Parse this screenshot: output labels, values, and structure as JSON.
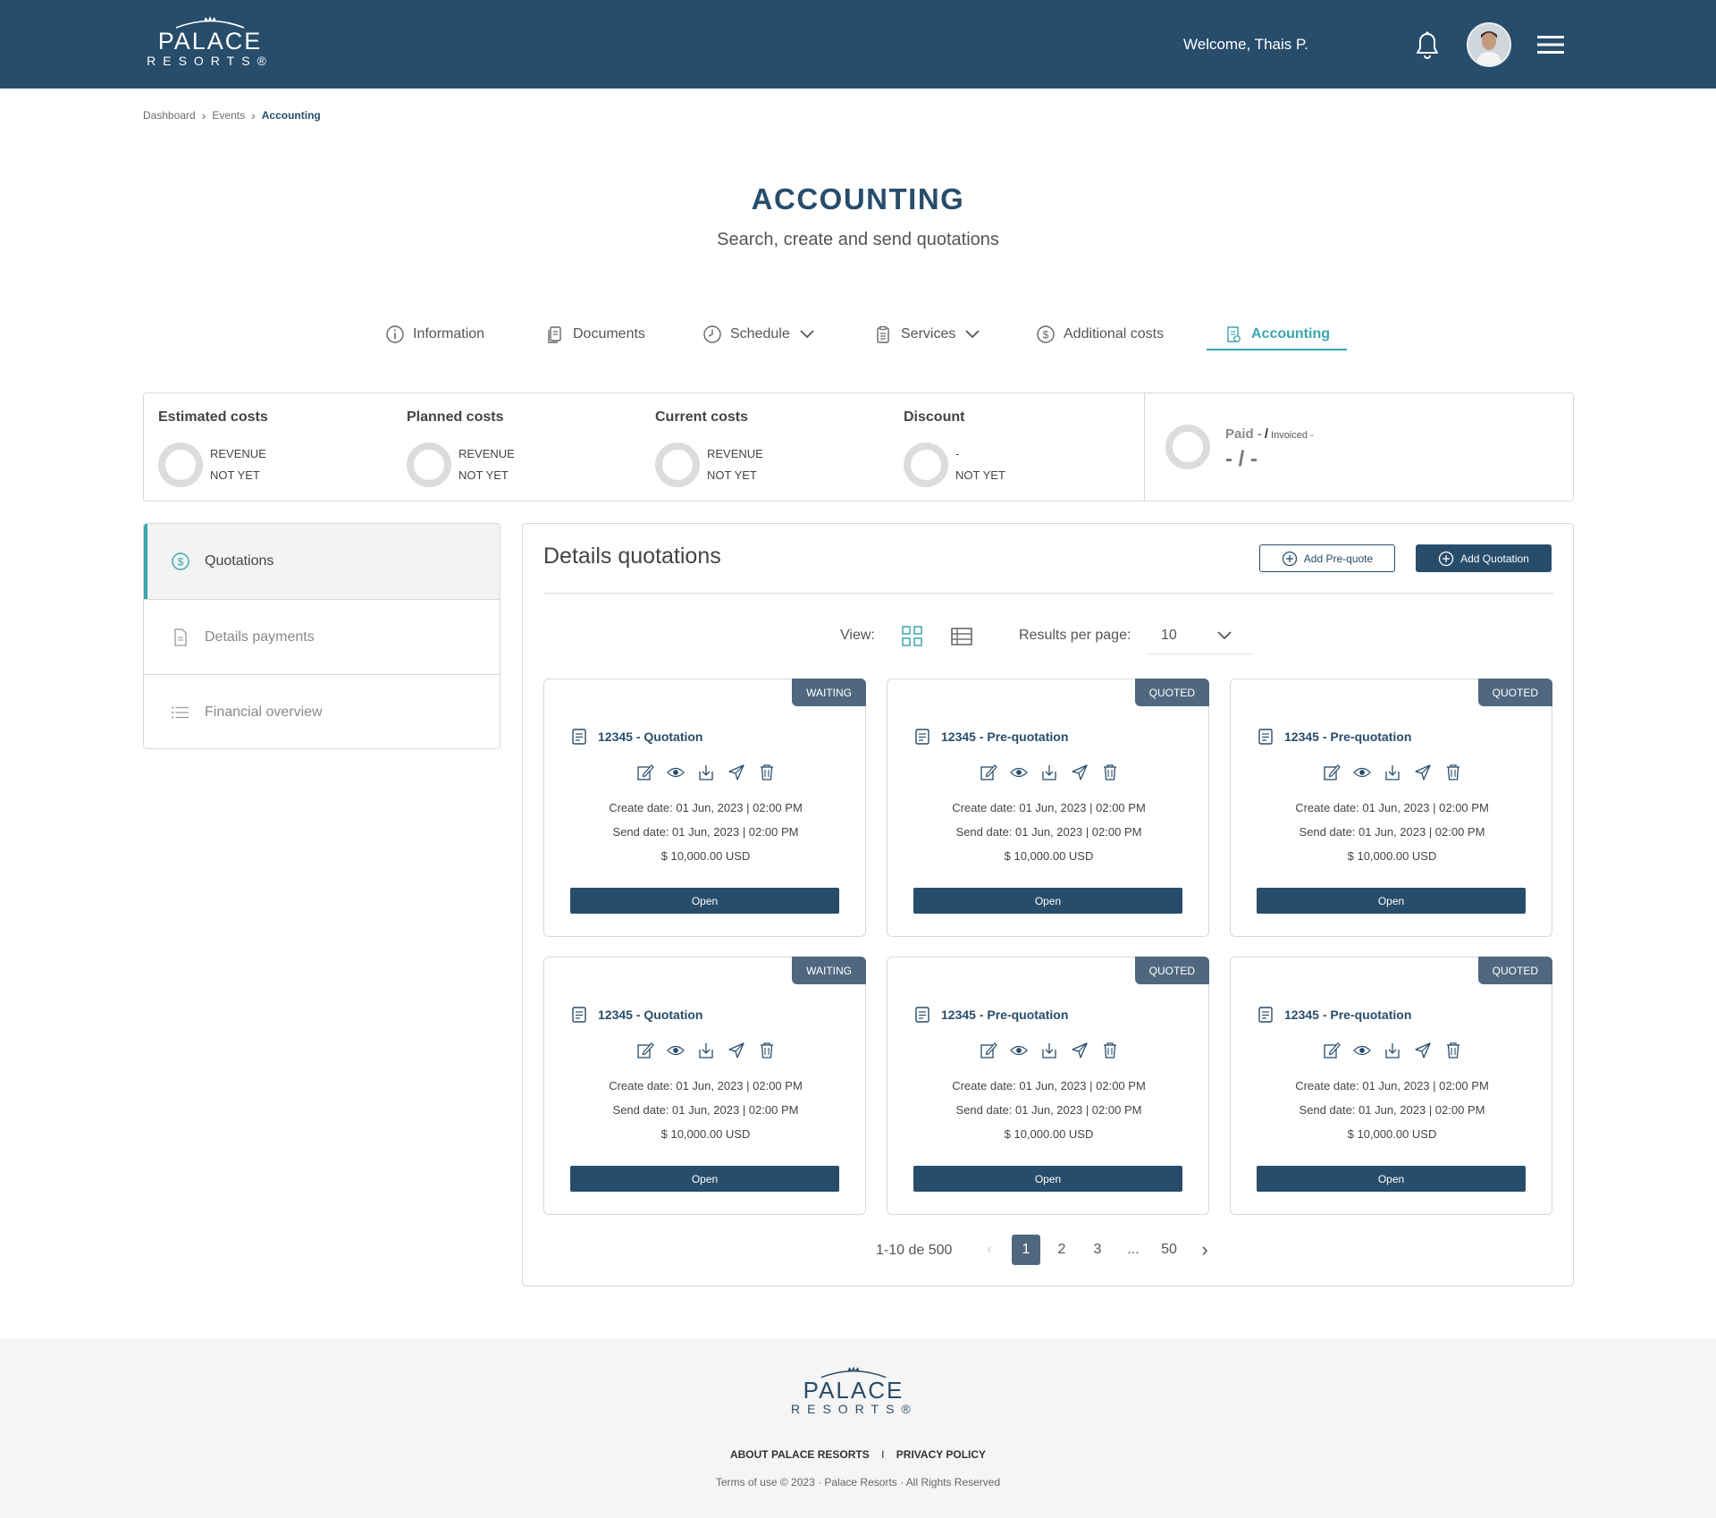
{
  "header": {
    "logo_line1": "PALACE",
    "logo_line2": "RESORTS®",
    "welcome": "Welcome, Thais P."
  },
  "breadcrumb": [
    "Dashboard",
    "Events",
    "Accounting"
  ],
  "page": {
    "title": "ACCOUNTING",
    "subtitle": "Search, create and send quotations"
  },
  "tabs": [
    {
      "label": "Information",
      "icon": "info-icon"
    },
    {
      "label": "Documents",
      "icon": "documents-icon"
    },
    {
      "label": "Schedule",
      "icon": "clock-icon",
      "dropdown": true
    },
    {
      "label": "Services",
      "icon": "clipboard-icon",
      "dropdown": true
    },
    {
      "label": "Additional costs",
      "icon": "dollar-circle-icon"
    },
    {
      "label": "Accounting",
      "icon": "receipt-icon",
      "active": true
    }
  ],
  "summary": {
    "items": [
      {
        "label": "Estimated costs",
        "line1": "REVENUE",
        "line2": "NOT YET"
      },
      {
        "label": "Planned costs",
        "line1": "REVENUE",
        "line2": "NOT YET"
      },
      {
        "label": "Current costs",
        "line1": "REVENUE",
        "line2": "NOT YET"
      },
      {
        "label": "Discount",
        "line1": "-",
        "line2": "NOT YET"
      }
    ],
    "paid_label": "Paid -",
    "paid_sep": "/",
    "invoiced_label": "Invoiced -",
    "paid_value": "- / -"
  },
  "sidebar": {
    "items": [
      {
        "label": "Quotations",
        "icon": "dollar-circle-icon",
        "active": true
      },
      {
        "label": "Details payments",
        "icon": "document-icon"
      },
      {
        "label": "Financial overview",
        "icon": "list-icon"
      }
    ]
  },
  "panel": {
    "title": "Details quotations",
    "add_prequote": "Add Pre-quote",
    "add_quotation": "Add Quotation",
    "view_label": "View:",
    "rpp_label": "Results per page:",
    "rpp_value": "10"
  },
  "cards": [
    {
      "status": "WAITING",
      "title": "12345 - Quotation",
      "create": "Create date: 01 Jun, 2023 | 02:00 PM",
      "send": "Send date: 01 Jun, 2023 | 02:00 PM",
      "amount": "$ 10,000.00 USD",
      "open": "Open"
    },
    {
      "status": "QUOTED",
      "title": "12345 - Pre-quotation",
      "create": "Create date: 01 Jun, 2023 | 02:00 PM",
      "send": "Send date: 01 Jun, 2023 | 02:00 PM",
      "amount": "$ 10,000.00 USD",
      "open": "Open"
    },
    {
      "status": "QUOTED",
      "title": "12345 - Pre-quotation",
      "create": "Create date: 01 Jun, 2023 | 02:00 PM",
      "send": "Send date: 01 Jun, 2023 | 02:00 PM",
      "amount": "$ 10,000.00 USD",
      "open": "Open"
    },
    {
      "status": "WAITING",
      "title": "12345 - Quotation",
      "create": "Create date: 01 Jun, 2023 | 02:00 PM",
      "send": "Send date: 01 Jun, 2023 | 02:00 PM",
      "amount": "$ 10,000.00 USD",
      "open": "Open"
    },
    {
      "status": "QUOTED",
      "title": "12345 - Pre-quotation",
      "create": "Create date: 01 Jun, 2023 | 02:00 PM",
      "send": "Send date: 01 Jun, 2023 | 02:00 PM",
      "amount": "$ 10,000.00 USD",
      "open": "Open"
    },
    {
      "status": "QUOTED",
      "title": "12345 - Pre-quotation",
      "create": "Create date: 01 Jun, 2023 | 02:00 PM",
      "send": "Send date: 01 Jun, 2023 | 02:00 PM",
      "amount": "$ 10,000.00 USD",
      "open": "Open"
    }
  ],
  "pagination": {
    "range": "1-10 de 500",
    "pages": [
      "1",
      "2",
      "3",
      "...",
      "50"
    ],
    "current": "1"
  },
  "footer": {
    "logo_line1": "PALACE",
    "logo_line2": "RESORTS®",
    "about": "ABOUT PALACE RESORTS",
    "separator": "I",
    "privacy": "PRIVACY POLICY",
    "copyright": "Terms of use © 2023 · Palace Resorts · All Rights Reserved"
  },
  "colors": {
    "header_bg": "#284d6b",
    "accent_teal": "#3aa6ae",
    "badge_bg": "#4f6880",
    "button_primary": "#284d6b"
  }
}
